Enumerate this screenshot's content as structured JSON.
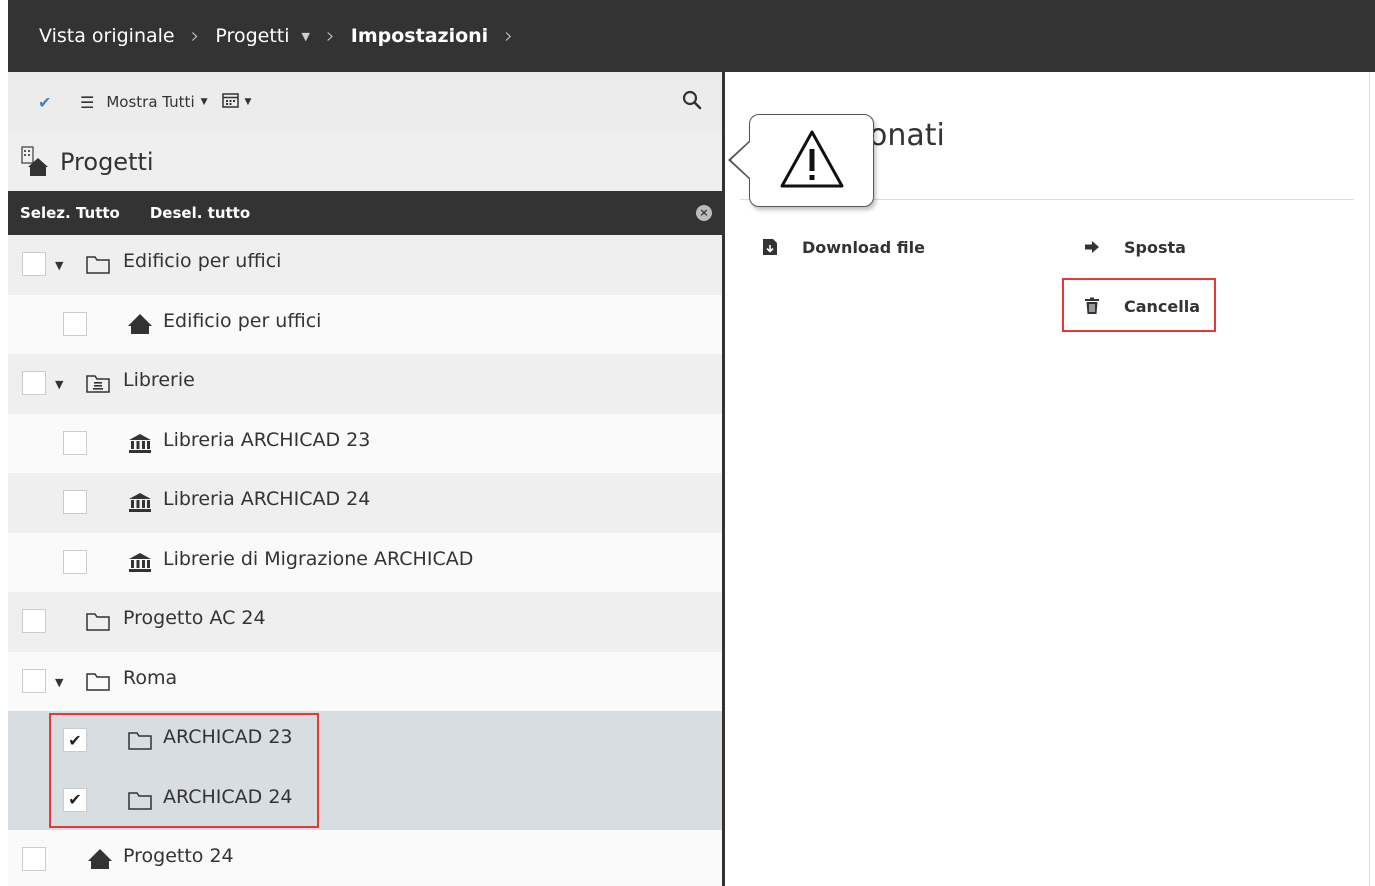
{
  "breadcrumb": {
    "items": [
      {
        "label": "Vista originale",
        "bold": false,
        "caret": false
      },
      {
        "label": "Progetti",
        "bold": false,
        "caret": true
      },
      {
        "label": "Impostazioni",
        "bold": true,
        "caret": false
      }
    ]
  },
  "toolbar": {
    "filter_label": "Mostra Tutti",
    "icons": [
      "check-icon",
      "list-icon",
      "calendar-icon",
      "search-icon"
    ]
  },
  "panel": {
    "title": "Progetti",
    "select_all": "Selez. Tutto",
    "deselect_all": "Desel. tutto"
  },
  "tree": [
    {
      "label": "Edificio per uffici",
      "icon": "folder-icon",
      "expanded": true,
      "checked": false,
      "level": 0
    },
    {
      "label": "Edificio per uffici",
      "icon": "house-icon",
      "expanded": null,
      "checked": false,
      "level": 1
    },
    {
      "label": "Librerie",
      "icon": "library-folder-icon",
      "expanded": true,
      "checked": false,
      "level": 0
    },
    {
      "label": "Libreria ARCHICAD 23",
      "icon": "library-icon",
      "expanded": null,
      "checked": false,
      "level": 1
    },
    {
      "label": "Libreria ARCHICAD 24",
      "icon": "library-icon",
      "expanded": null,
      "checked": false,
      "level": 1
    },
    {
      "label": "Librerie di Migrazione ARCHICAD",
      "icon": "library-icon",
      "expanded": null,
      "checked": false,
      "level": 1
    },
    {
      "label": "Progetto AC 24",
      "icon": "folder-icon",
      "expanded": null,
      "checked": false,
      "level": 0
    },
    {
      "label": "Roma",
      "icon": "folder-icon",
      "expanded": true,
      "checked": false,
      "level": 0
    },
    {
      "label": "ARCHICAD 23",
      "icon": "folder-icon",
      "expanded": null,
      "checked": true,
      "level": 1
    },
    {
      "label": "ARCHICAD 24",
      "icon": "folder-icon",
      "expanded": null,
      "checked": true,
      "level": 1
    },
    {
      "label": "Progetto 24",
      "icon": "house-icon",
      "expanded": null,
      "checked": false,
      "level": 0
    }
  ],
  "right": {
    "title_partial": "onati",
    "actions": {
      "download": "Download file",
      "move": "Sposta",
      "delete": "Cancella"
    }
  },
  "colors": {
    "dark_bar": "#333333",
    "accent_check": "#3a87c8",
    "highlight": "#e53935",
    "selected_row": "#d8dde2"
  }
}
